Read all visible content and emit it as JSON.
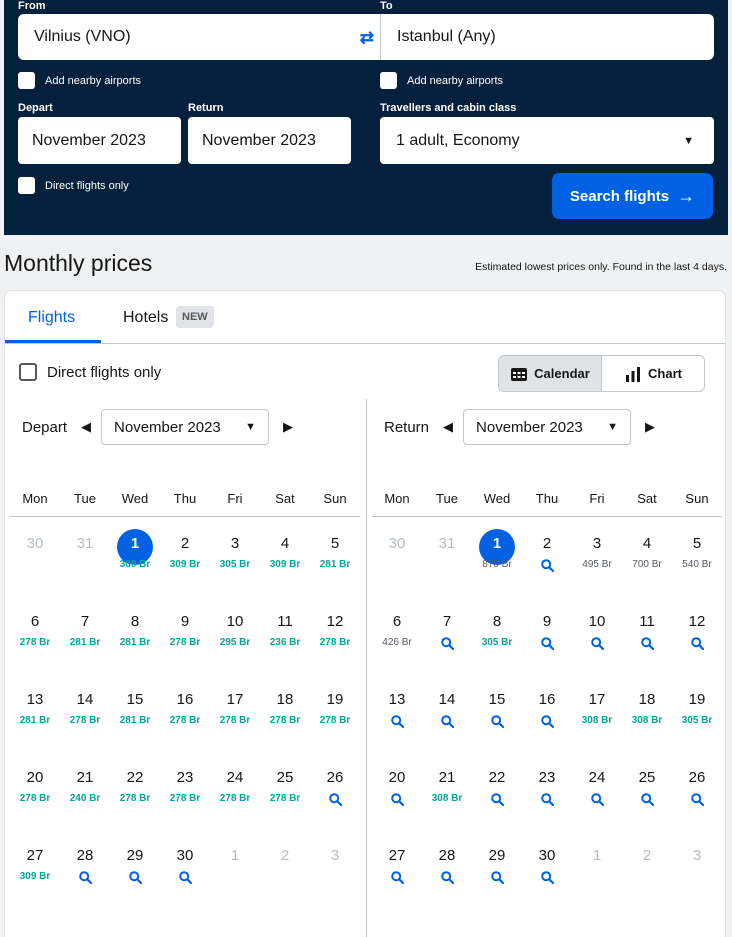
{
  "search": {
    "from_label": "From",
    "from_value": "Vilnius (VNO)",
    "to_label": "To",
    "to_value": "Istanbul (Any)",
    "nearby_from": "Add nearby airports",
    "nearby_to": "Add nearby airports",
    "depart_label": "Depart",
    "depart_value": "November 2023",
    "return_label": "Return",
    "return_value": "November 2023",
    "travellers_label": "Travellers and cabin class",
    "travellers_value": "1 adult, Economy",
    "direct_only": "Direct flights only",
    "search_button": "Search flights"
  },
  "header": {
    "title": "Monthly prices",
    "note": "Estimated lowest prices only. Found in the last 4 days."
  },
  "tabs": {
    "flights": "Flights",
    "hotels": "Hotels",
    "new_badge": "NEW"
  },
  "filters": {
    "direct_only": "Direct flights only",
    "calendar": "Calendar",
    "chart": "Chart"
  },
  "weekdays": [
    "Mon",
    "Tue",
    "Wed",
    "Thu",
    "Fri",
    "Sat",
    "Sun"
  ],
  "depart_cal": {
    "label": "Depart",
    "month": "November 2023",
    "weeks": [
      [
        [
          "30",
          ""
        ],
        [
          "31",
          ""
        ],
        [
          "1",
          "309 Br"
        ],
        [
          "2",
          "309 Br"
        ],
        [
          "3",
          "305 Br"
        ],
        [
          "4",
          "309 Br"
        ],
        [
          "5",
          "281 Br"
        ]
      ],
      [
        [
          "6",
          "278 Br"
        ],
        [
          "7",
          "281 Br"
        ],
        [
          "8",
          "281 Br"
        ],
        [
          "9",
          "278 Br"
        ],
        [
          "10",
          "295 Br"
        ],
        [
          "11",
          "236 Br"
        ],
        [
          "12",
          "278 Br"
        ]
      ],
      [
        [
          "13",
          "281 Br"
        ],
        [
          "14",
          "278 Br"
        ],
        [
          "15",
          "281 Br"
        ],
        [
          "16",
          "278 Br"
        ],
        [
          "17",
          "278 Br"
        ],
        [
          "18",
          "278 Br"
        ],
        [
          "19",
          "278 Br"
        ]
      ],
      [
        [
          "20",
          "278 Br"
        ],
        [
          "21",
          "240 Br"
        ],
        [
          "22",
          "278 Br"
        ],
        [
          "23",
          "278 Br"
        ],
        [
          "24",
          "278 Br"
        ],
        [
          "25",
          "278 Br"
        ],
        [
          "26",
          "?"
        ]
      ],
      [
        [
          "27",
          "309 Br"
        ],
        [
          "28",
          "?"
        ],
        [
          "29",
          "?"
        ],
        [
          "30",
          "?"
        ],
        [
          "1",
          ""
        ],
        [
          "2",
          ""
        ],
        [
          "3",
          ""
        ]
      ]
    ]
  },
  "return_cal": {
    "label": "Return",
    "month": "November 2023",
    "weeks": [
      [
        [
          "30",
          ""
        ],
        [
          "31",
          ""
        ],
        [
          "1",
          "n870 Br"
        ],
        [
          "2",
          "?"
        ],
        [
          "3",
          "n495 Br"
        ],
        [
          "4",
          "n700 Br"
        ],
        [
          "5",
          "n540 Br"
        ]
      ],
      [
        [
          "6",
          "n426 Br"
        ],
        [
          "7",
          "?"
        ],
        [
          "8",
          "305 Br"
        ],
        [
          "9",
          "?"
        ],
        [
          "10",
          "?"
        ],
        [
          "11",
          "?"
        ],
        [
          "12",
          "?"
        ]
      ],
      [
        [
          "13",
          "?"
        ],
        [
          "14",
          "?"
        ],
        [
          "15",
          "?"
        ],
        [
          "16",
          "?"
        ],
        [
          "17",
          "308 Br"
        ],
        [
          "18",
          "308 Br"
        ],
        [
          "19",
          "305 Br"
        ]
      ],
      [
        [
          "20",
          "?"
        ],
        [
          "21",
          "308 Br"
        ],
        [
          "22",
          "?"
        ],
        [
          "23",
          "?"
        ],
        [
          "24",
          "?"
        ],
        [
          "25",
          "?"
        ],
        [
          "26",
          "?"
        ]
      ],
      [
        [
          "27",
          "?"
        ],
        [
          "28",
          "?"
        ],
        [
          "29",
          "?"
        ],
        [
          "30",
          "?"
        ],
        [
          "1",
          ""
        ],
        [
          "2",
          ""
        ],
        [
          "3",
          ""
        ]
      ]
    ]
  },
  "colors": {
    "brand": "#05203c",
    "accent": "#0062e3",
    "price_green": "#00a698"
  }
}
